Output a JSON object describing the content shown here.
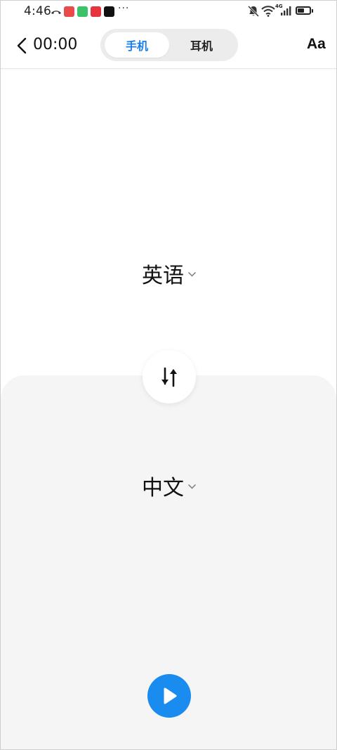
{
  "status_bar": {
    "time": "4:46",
    "more_indicator": "···",
    "network_label": "4G",
    "battery_level": 0.55,
    "app_icons": [
      "#e94b4b",
      "#3cc36a",
      "#e6343f",
      "#111111"
    ]
  },
  "header": {
    "timer": "00:00",
    "tabs": [
      {
        "label": "手机",
        "active": true
      },
      {
        "label": "耳机",
        "active": false
      }
    ],
    "font_size_label": "Aa"
  },
  "source_language": {
    "label": "英语"
  },
  "target_language": {
    "label": "中文"
  },
  "colors": {
    "accent": "#1a7fe8",
    "panel": "#f5f5f5",
    "play": "#1a8cf0"
  }
}
